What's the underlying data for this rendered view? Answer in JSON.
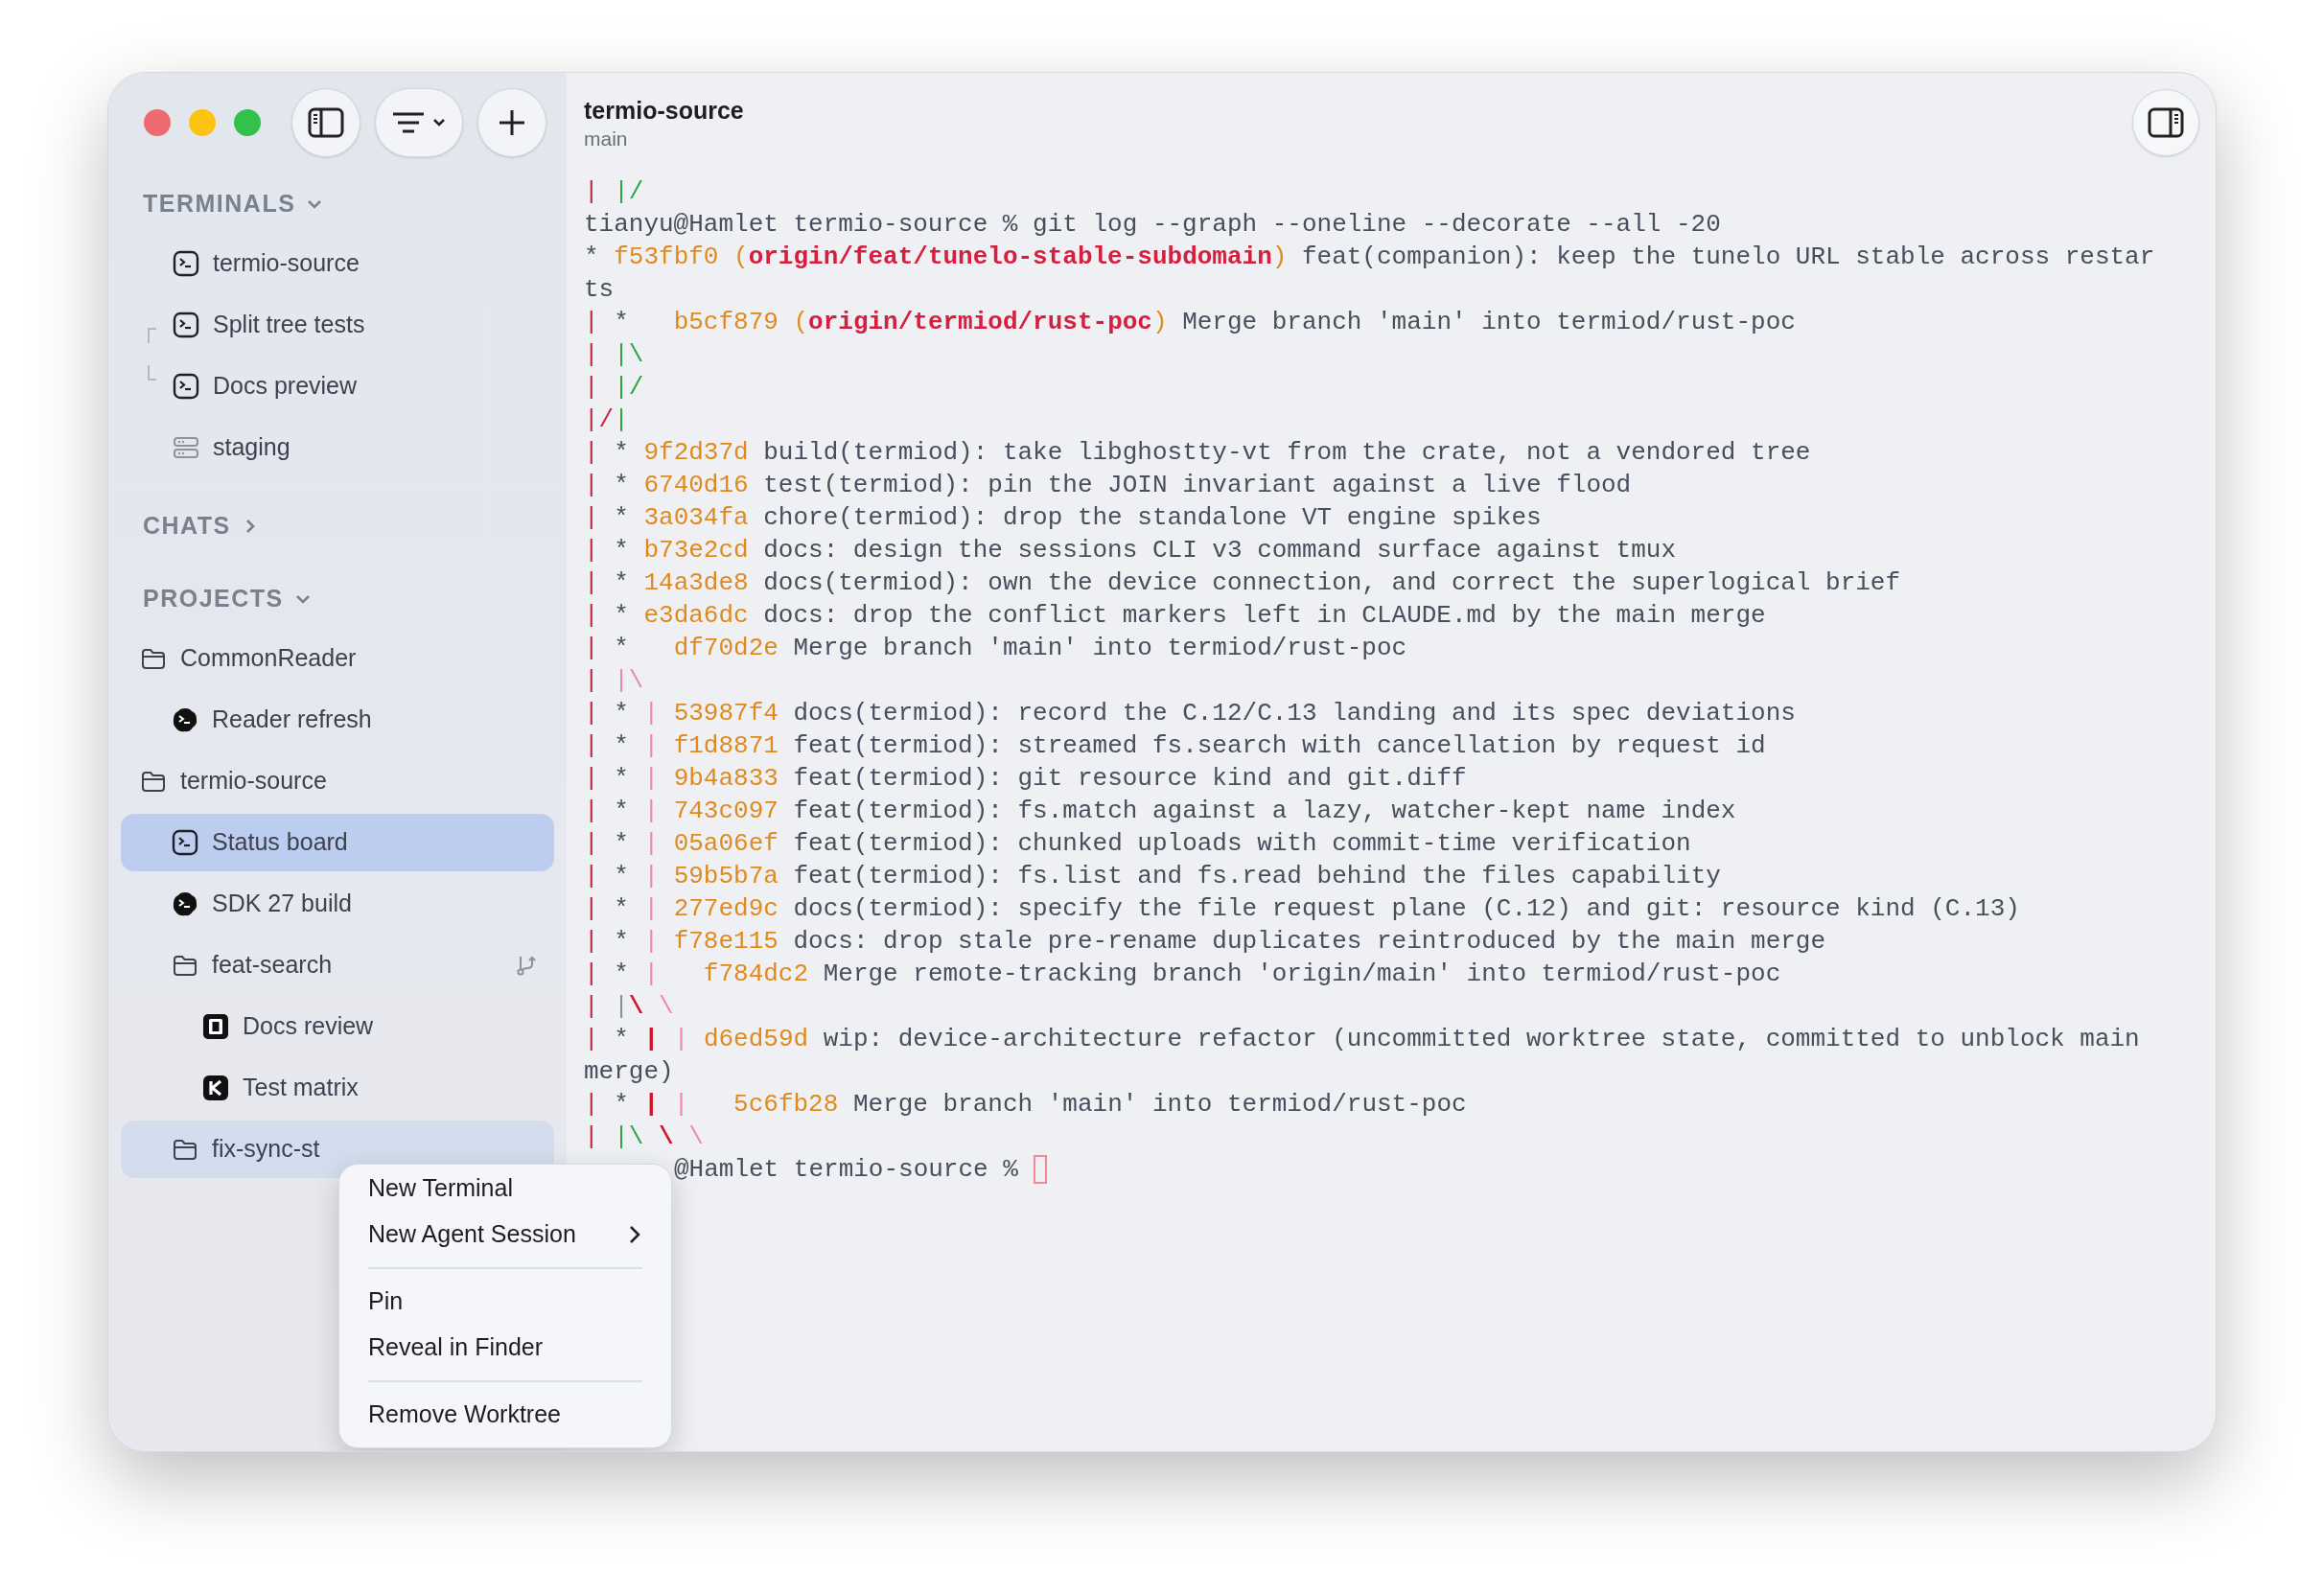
{
  "sidebar": {
    "sections": [
      {
        "title": "TERMINALS",
        "expanded": true,
        "items": [
          {
            "label": "termio-source",
            "kind": "terminal",
            "selected": false,
            "menu_target": false
          },
          {
            "label": "Split tree tests",
            "kind": "terminal-split-first",
            "selected": false,
            "menu_target": false
          },
          {
            "label": "Docs preview",
            "kind": "terminal-split-last",
            "selected": false,
            "menu_target": false
          },
          {
            "label": "staging",
            "kind": "server",
            "selected": false,
            "menu_target": false
          }
        ]
      },
      {
        "title": "CHATS",
        "expanded": false
      },
      {
        "title": "PROJECTS",
        "expanded": true,
        "items": [
          {
            "label": "CommonReader",
            "kind": "folder",
            "worktree": false,
            "selected": false,
            "menu_target": false,
            "children": [
              {
                "label": "Reader refresh",
                "kind": "agent",
                "worktree": false,
                "selected": false,
                "menu_target": false
              }
            ]
          },
          {
            "label": "termio-source",
            "kind": "folder",
            "worktree": false,
            "selected": false,
            "menu_target": false,
            "children": [
              {
                "label": "Status board",
                "kind": "terminal",
                "worktree": false,
                "selected": true,
                "menu_target": false
              },
              {
                "label": "SDK 27 build",
                "kind": "agent",
                "worktree": false,
                "selected": false,
                "menu_target": false
              },
              {
                "label": "feat-search",
                "kind": "folder",
                "worktree": true,
                "selected": false,
                "menu_target": false,
                "children": [
                  {
                    "label": "Docs review",
                    "kind": "app-square",
                    "worktree": false,
                    "selected": false,
                    "menu_target": false
                  },
                  {
                    "label": "Test matrix",
                    "kind": "app-k",
                    "worktree": false,
                    "selected": false,
                    "menu_target": false
                  }
                ]
              },
              {
                "label": "fix-sync-st",
                "kind": "folder",
                "worktree": false,
                "selected": false,
                "menu_target": true
              }
            ]
          }
        ]
      }
    ]
  },
  "terminal": {
    "title": "termio-source",
    "branch": "main",
    "lines": [
      {
        "segments": [
          {
            "kind": "graph-red",
            "text": "| "
          },
          {
            "kind": "graph-green",
            "text": "|/"
          }
        ]
      },
      {
        "segments": [
          {
            "kind": "text",
            "text": "tianyu@Hamlet termio-source % git log --graph --oneline --decorate --all -20"
          }
        ]
      },
      {
        "segments": [
          {
            "kind": "text",
            "text": "* "
          },
          {
            "kind": "hash",
            "text": "f53fbf0 ("
          },
          {
            "kind": "ref",
            "text": "origin/feat/tunelo-stable-subdomain"
          },
          {
            "kind": "hash",
            "text": ")"
          },
          {
            "kind": "text",
            "text": " feat(companion): keep the tunelo URL stable across restar"
          }
        ]
      },
      {
        "segments": [
          {
            "kind": "text",
            "text": "ts"
          }
        ]
      },
      {
        "segments": [
          {
            "kind": "graph-red",
            "text": "| "
          },
          {
            "kind": "text",
            "text": "*   "
          },
          {
            "kind": "hash",
            "text": "b5cf879 ("
          },
          {
            "kind": "ref",
            "text": "origin/termiod/rust-poc"
          },
          {
            "kind": "hash",
            "text": ")"
          },
          {
            "kind": "text",
            "text": " Merge branch 'main' into termiod/rust-poc"
          }
        ]
      },
      {
        "segments": [
          {
            "kind": "graph-red",
            "text": "| "
          },
          {
            "kind": "graph-green",
            "text": "|\\"
          }
        ]
      },
      {
        "segments": [
          {
            "kind": "graph-red",
            "text": "| "
          },
          {
            "kind": "graph-green",
            "text": "|/"
          }
        ]
      },
      {
        "segments": [
          {
            "kind": "graph-red",
            "text": "|/"
          },
          {
            "kind": "graph-green",
            "text": "|"
          }
        ]
      },
      {
        "segments": [
          {
            "kind": "graph-red",
            "text": "| "
          },
          {
            "kind": "text",
            "text": "* "
          },
          {
            "kind": "hash",
            "text": "9f2d37d"
          },
          {
            "kind": "text",
            "text": " build(termiod): take libghostty-vt from the crate, not a vendored tree"
          }
        ]
      },
      {
        "segments": [
          {
            "kind": "graph-red",
            "text": "| "
          },
          {
            "kind": "text",
            "text": "* "
          },
          {
            "kind": "hash",
            "text": "6740d16"
          },
          {
            "kind": "text",
            "text": " test(termiod): pin the JOIN invariant against a live flood"
          }
        ]
      },
      {
        "segments": [
          {
            "kind": "graph-red",
            "text": "| "
          },
          {
            "kind": "text",
            "text": "* "
          },
          {
            "kind": "hash",
            "text": "3a034fa"
          },
          {
            "kind": "text",
            "text": " chore(termiod): drop the standalone VT engine spikes"
          }
        ]
      },
      {
        "segments": [
          {
            "kind": "graph-red",
            "text": "| "
          },
          {
            "kind": "text",
            "text": "* "
          },
          {
            "kind": "hash",
            "text": "b73e2cd"
          },
          {
            "kind": "text",
            "text": " docs: design the sessions CLI v3 command surface against tmux"
          }
        ]
      },
      {
        "segments": [
          {
            "kind": "graph-red",
            "text": "| "
          },
          {
            "kind": "text",
            "text": "* "
          },
          {
            "kind": "hash",
            "text": "14a3de8"
          },
          {
            "kind": "text",
            "text": " docs(termiod): own the device connection, and correct the superlogical brief"
          }
        ]
      },
      {
        "segments": [
          {
            "kind": "graph-red",
            "text": "| "
          },
          {
            "kind": "text",
            "text": "* "
          },
          {
            "kind": "hash",
            "text": "e3da6dc"
          },
          {
            "kind": "text",
            "text": " docs: drop the conflict markers left in CLAUDE.md by the main merge"
          }
        ]
      },
      {
        "segments": [
          {
            "kind": "graph-red",
            "text": "| "
          },
          {
            "kind": "text",
            "text": "*   "
          },
          {
            "kind": "hash",
            "text": "df70d2e"
          },
          {
            "kind": "text",
            "text": " Merge branch 'main' into termiod/rust-poc"
          }
        ]
      },
      {
        "segments": [
          {
            "kind": "graph-red",
            "text": "| "
          },
          {
            "kind": "graph-pink",
            "text": "|\\"
          }
        ]
      },
      {
        "segments": [
          {
            "kind": "graph-red",
            "text": "| "
          },
          {
            "kind": "text",
            "text": "* "
          },
          {
            "kind": "graph-pink",
            "text": "| "
          },
          {
            "kind": "hash",
            "text": "53987f4"
          },
          {
            "kind": "text",
            "text": " docs(termiod): record the C.12/C.13 landing and its spec deviations"
          }
        ]
      },
      {
        "segments": [
          {
            "kind": "graph-red",
            "text": "| "
          },
          {
            "kind": "text",
            "text": "* "
          },
          {
            "kind": "graph-pink",
            "text": "| "
          },
          {
            "kind": "hash",
            "text": "f1d8871"
          },
          {
            "kind": "text",
            "text": " feat(termiod): streamed fs.search with cancellation by request id"
          }
        ]
      },
      {
        "segments": [
          {
            "kind": "graph-red",
            "text": "| "
          },
          {
            "kind": "text",
            "text": "* "
          },
          {
            "kind": "graph-pink",
            "text": "| "
          },
          {
            "kind": "hash",
            "text": "9b4a833"
          },
          {
            "kind": "text",
            "text": " feat(termiod): git resource kind and git.diff"
          }
        ]
      },
      {
        "segments": [
          {
            "kind": "graph-red",
            "text": "| "
          },
          {
            "kind": "text",
            "text": "* "
          },
          {
            "kind": "graph-pink",
            "text": "| "
          },
          {
            "kind": "hash",
            "text": "743c097"
          },
          {
            "kind": "text",
            "text": " feat(termiod): fs.match against a lazy, watcher-kept name index"
          }
        ]
      },
      {
        "segments": [
          {
            "kind": "graph-red",
            "text": "| "
          },
          {
            "kind": "text",
            "text": "* "
          },
          {
            "kind": "graph-pink",
            "text": "| "
          },
          {
            "kind": "hash",
            "text": "05a06ef"
          },
          {
            "kind": "text",
            "text": " feat(termiod): chunked uploads with commit-time verification"
          }
        ]
      },
      {
        "segments": [
          {
            "kind": "graph-red",
            "text": "| "
          },
          {
            "kind": "text",
            "text": "* "
          },
          {
            "kind": "graph-pink",
            "text": "| "
          },
          {
            "kind": "hash",
            "text": "59b5b7a"
          },
          {
            "kind": "text",
            "text": " feat(termiod): fs.list and fs.read behind the files capability"
          }
        ]
      },
      {
        "segments": [
          {
            "kind": "graph-red",
            "text": "| "
          },
          {
            "kind": "text",
            "text": "* "
          },
          {
            "kind": "graph-pink",
            "text": "| "
          },
          {
            "kind": "hash",
            "text": "277ed9c"
          },
          {
            "kind": "text",
            "text": " docs(termiod): specify the file request plane (C.12) and git: resource kind (C.13)"
          }
        ]
      },
      {
        "segments": [
          {
            "kind": "graph-red",
            "text": "| "
          },
          {
            "kind": "text",
            "text": "* "
          },
          {
            "kind": "graph-pink",
            "text": "| "
          },
          {
            "kind": "hash",
            "text": "f78e115"
          },
          {
            "kind": "text",
            "text": " docs: drop stale pre-rename duplicates reintroduced by the main merge"
          }
        ]
      },
      {
        "segments": [
          {
            "kind": "graph-red",
            "text": "| "
          },
          {
            "kind": "text",
            "text": "* "
          },
          {
            "kind": "graph-pink",
            "text": "|   "
          },
          {
            "kind": "hash",
            "text": "f784dc2"
          },
          {
            "kind": "text",
            "text": " Merge remote-tracking branch 'origin/main' into termiod/rust-poc"
          }
        ]
      },
      {
        "segments": [
          {
            "kind": "graph-red",
            "text": "| "
          },
          {
            "kind": "graph-grey",
            "text": "|"
          },
          {
            "kind": "graph-bold",
            "text": "\\"
          },
          {
            "kind": "graph-pink",
            "text": " \\"
          }
        ]
      },
      {
        "segments": [
          {
            "kind": "graph-red",
            "text": "| "
          },
          {
            "kind": "text",
            "text": "* "
          },
          {
            "kind": "graph-bold",
            "text": "| "
          },
          {
            "kind": "graph-pink",
            "text": "| "
          },
          {
            "kind": "hash",
            "text": "d6ed59d"
          },
          {
            "kind": "text",
            "text": " wip: device-architecture refactor (uncommitted worktree state, committed to unblock main"
          }
        ]
      },
      {
        "segments": [
          {
            "kind": "text",
            "text": "merge)"
          }
        ]
      },
      {
        "segments": [
          {
            "kind": "graph-red",
            "text": "| "
          },
          {
            "kind": "text",
            "text": "* "
          },
          {
            "kind": "graph-bold",
            "text": "| "
          },
          {
            "kind": "graph-pink",
            "text": "|   "
          },
          {
            "kind": "hash",
            "text": "5c6fb28"
          },
          {
            "kind": "text",
            "text": " Merge branch 'main' into termiod/rust-poc"
          }
        ]
      },
      {
        "segments": [
          {
            "kind": "graph-red",
            "text": "| "
          },
          {
            "kind": "graph-green",
            "text": "|\\"
          },
          {
            "kind": "graph-bold",
            "text": " \\"
          },
          {
            "kind": "graph-pink",
            "text": " \\"
          }
        ]
      }
    ],
    "prompt": {
      "text": "@Hamlet termio-source %",
      "cursor": true
    }
  },
  "context_menu": {
    "items": [
      {
        "kind": "item",
        "label": "New Terminal",
        "submenu": false
      },
      {
        "kind": "item",
        "label": "New Agent Session",
        "submenu": true
      },
      {
        "kind": "separator"
      },
      {
        "kind": "item",
        "label": "Pin",
        "submenu": false
      },
      {
        "kind": "item",
        "label": "Reveal in Finder",
        "submenu": false
      },
      {
        "kind": "separator"
      },
      {
        "kind": "item",
        "label": "Remove Worktree",
        "submenu": false
      }
    ]
  }
}
